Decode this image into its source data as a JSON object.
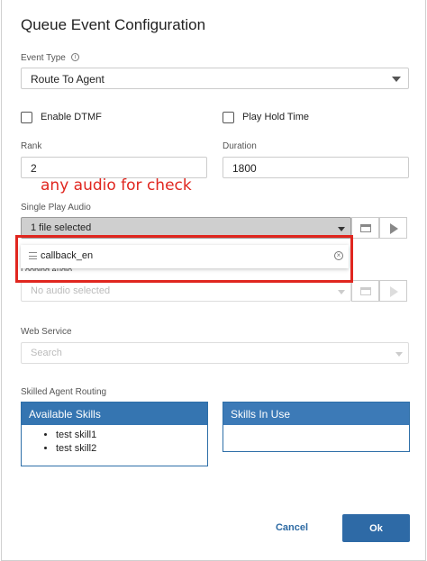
{
  "dialog": {
    "title": "Queue Event Configuration"
  },
  "event_type": {
    "label": "Event Type",
    "value": "Route To Agent"
  },
  "options": {
    "enable_dtmf_label": "Enable DTMF",
    "enable_dtmf_checked": false,
    "play_hold_time_label": "Play Hold Time",
    "play_hold_time_checked": false
  },
  "rank": {
    "label": "Rank",
    "value": "2"
  },
  "duration": {
    "label": "Duration",
    "value": "1800"
  },
  "annotation": {
    "text": "any audio for check",
    "color": "#e0261f"
  },
  "single_play_audio": {
    "label": "Single Play Audio",
    "value": "1 file selected",
    "selected_files": [
      "callback_en"
    ]
  },
  "looping_audio": {
    "label": "Looping Audio",
    "placeholder": "No audio selected"
  },
  "web_service": {
    "label": "Web Service",
    "placeholder": "Search"
  },
  "skills": {
    "section_label": "Skilled Agent Routing",
    "available_title": "Available Skills",
    "available_items": [
      "test skill1",
      "test skill2"
    ],
    "in_use_title": "Skills In Use",
    "in_use_items": []
  },
  "footer": {
    "cancel_label": "Cancel",
    "ok_label": "Ok"
  },
  "colors": {
    "primary": "#2e6aa6",
    "highlight": "#e0261f",
    "header": "#3575b1"
  }
}
